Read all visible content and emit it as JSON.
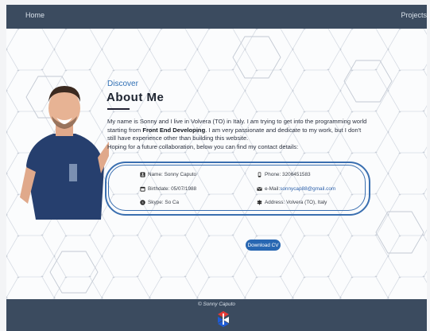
{
  "nav": {
    "home_label": "Home",
    "projects_label": "Projects"
  },
  "about": {
    "discover_label": "Discover",
    "title": "About Me",
    "bio_line1": "My name is Sonny and I live in Volvera (TO) in Italy. I am trying to get into the programming world",
    "bio_line2_pre": "starting from ",
    "bio_line2_bold": "Front End Developing",
    "bio_line2_post": ". I am very passionate and dedicate to my work, but I don't",
    "bio_line3": "still have experience other than building this website.",
    "bio_line4": "Hoping for a future collaboration, below you can find my contact details:"
  },
  "contact": {
    "name": "Name: Sonny Caputo",
    "birthdate": "Birthdate: 05/07/1988",
    "skype": "Skype: So Ca",
    "phone": "Phone: 3206451583",
    "email_label": "e-Mail: ",
    "email_value": "sonnycap88@gmail.com",
    "address": "Address: Volvera (TO), Italy"
  },
  "cv_button_label": "Download CV",
  "footer": {
    "copyright": "© Sonny Caputo"
  },
  "colors": {
    "navbar": "#3b4b5f",
    "accent": "#2867b2",
    "heading": "#1d2430"
  },
  "icons": {
    "name": "id-card-icon",
    "birthdate": "calendar-icon",
    "skype": "skype-icon",
    "phone": "phone-icon",
    "email": "envelope-icon",
    "address": "map-sign-icon"
  }
}
